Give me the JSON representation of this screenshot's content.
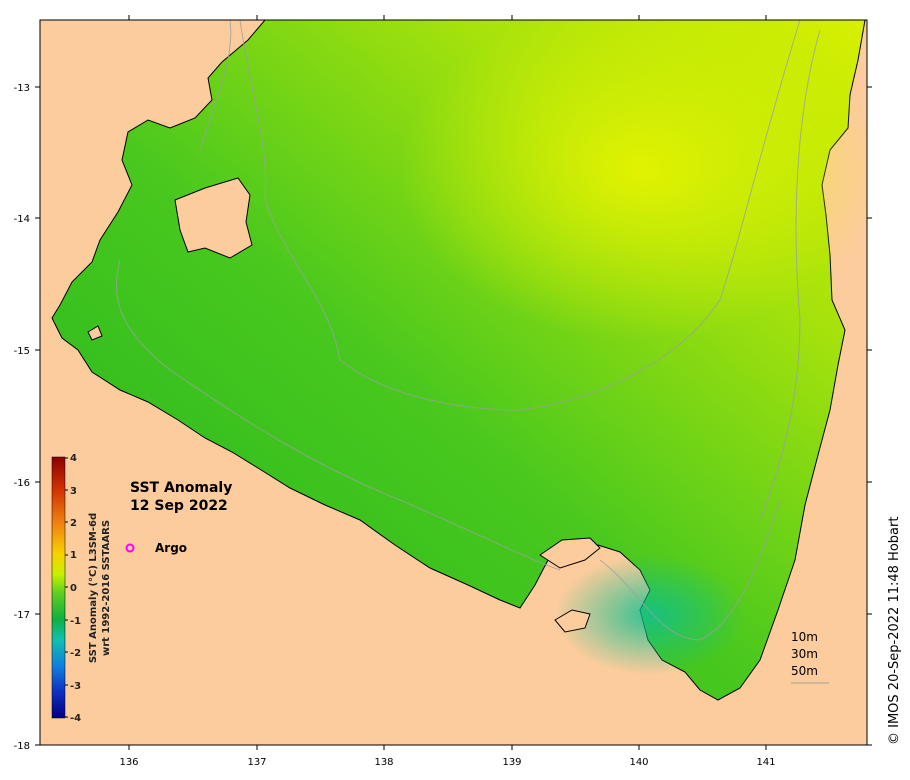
{
  "map": {
    "title_line1": "SST Anomaly",
    "title_line2": "12 Sep 2022",
    "legend_argo_label": "Argo",
    "credit": "© IMOS 20-Sep-2022 11:48 Hobart",
    "colorbar_label_line1": "SST Anomaly (°C) L3SM-6d",
    "colorbar_label_line2": "wrt 1992-2016 SSTAARS",
    "colorbar_ticks": [
      "4",
      "3",
      "2",
      "1",
      "0",
      "-1",
      "-2",
      "-3",
      "-4"
    ],
    "depth_labels": [
      "10m",
      "30m",
      "50m"
    ],
    "x_ticks": [
      "136",
      "137",
      "138",
      "139",
      "140",
      "141"
    ],
    "y_ticks": [
      "-13",
      "-14",
      "-15",
      "-16",
      "-17",
      "-18"
    ],
    "colors": {
      "land": "#fccc9c",
      "ocean_warm": "#d9f000",
      "ocean_mid": "#7fd800",
      "ocean_cool": "#1fb81f",
      "ocean_cold": "#14c07a",
      "argo_marker": "#ff00ff"
    }
  }
}
